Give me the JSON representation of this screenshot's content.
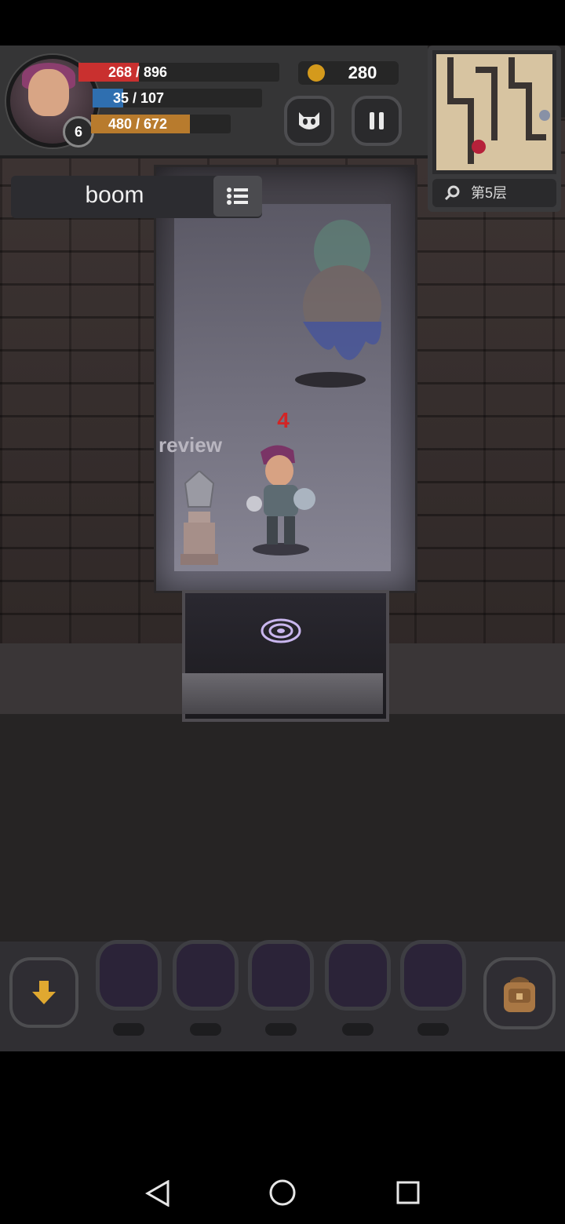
{
  "hud": {
    "level": "6",
    "hp": {
      "text": "268 / 896",
      "fraction": 0.3,
      "color": "#c9302f"
    },
    "mp": {
      "text": "35 / 107",
      "fraction": 0.09,
      "color": "#2f6fb0"
    },
    "xp": {
      "text": "480 / 672",
      "fraction": 0.71,
      "color": "#b87b2d"
    },
    "coins": "280"
  },
  "buttons": {
    "pet_icon": "face-icon",
    "pause_icon": "pause-icon"
  },
  "map": {
    "floor_label": "第5层",
    "search_icon": "magnifier-icon"
  },
  "player": {
    "name": "boom",
    "menu_icon": "list-icon"
  },
  "scene": {
    "review_label": "review",
    "damage_number": "4"
  },
  "itembar": {
    "slots": 5,
    "left_icon": "arrow-down-icon",
    "right_icon": "backpack-icon"
  },
  "navigation": {
    "back": "back-icon",
    "home": "home-icon",
    "recent": "recent-apps-icon"
  }
}
